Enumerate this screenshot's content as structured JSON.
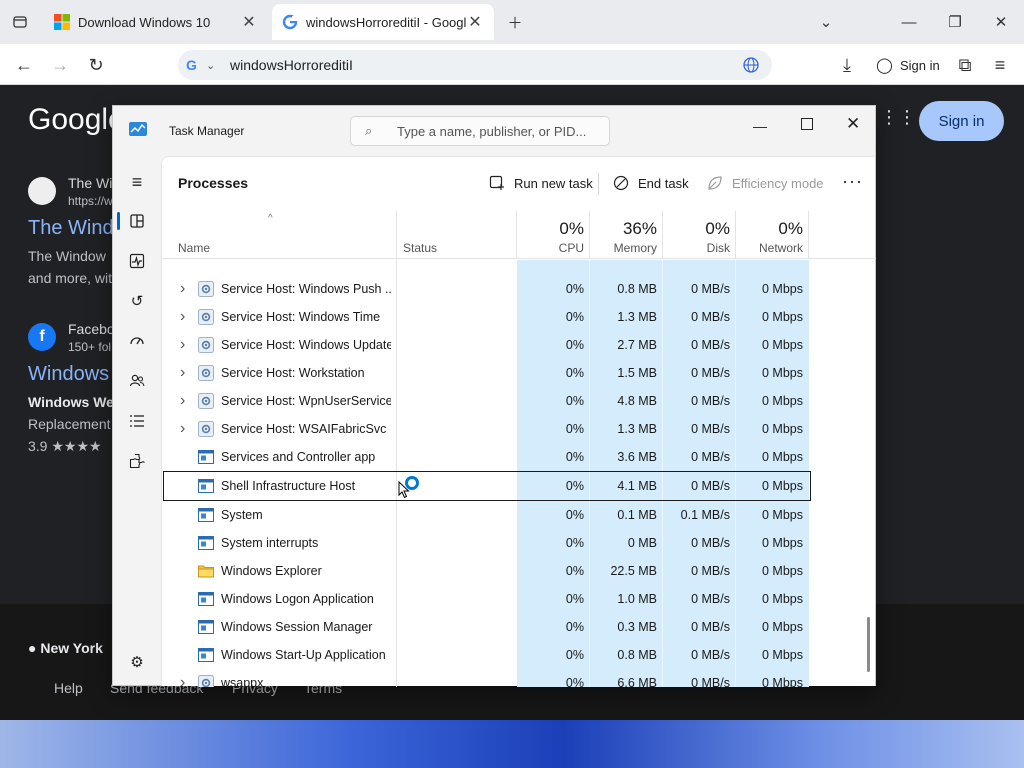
{
  "browser": {
    "tabs": [
      {
        "title": "Download Windows 10",
        "active": false
      },
      {
        "title": "windowsHorroreditiI - Google Se",
        "active": true
      }
    ],
    "address": "windowsHorroreditiI",
    "sign_in": "Sign in"
  },
  "google_page": {
    "logo": "Google",
    "sign_in": "Sign in",
    "result1_site": "The Wi",
    "result1_url": "https://w",
    "result1_title": "The Wind",
    "result1_snip1": "The Window",
    "result1_snip2": "and more, wit",
    "result2_site": "Facebo",
    "result2_sub": "150+ fol",
    "result2_title": "Windows",
    "result2_snip1": "Windows We",
    "result2_snip2": "Replacement",
    "result2_rating": "3.9 ★★★★",
    "footer_location": "New York",
    "footer_links": [
      "Help",
      "Send feedback",
      "Privacy",
      "Terms"
    ]
  },
  "task_manager": {
    "title": "Task Manager",
    "search_placeholder": "Type a name, publisher, or PID...",
    "section": "Processes",
    "run_new_task": "Run new task",
    "end_task": "End task",
    "efficiency_mode": "Efficiency mode",
    "columns": {
      "name": "Name",
      "status": "Status",
      "cpu_pct": "0%",
      "cpu": "CPU",
      "memory_pct": "36%",
      "memory": "Memory",
      "disk_pct": "0%",
      "disk": "Disk",
      "network_pct": "0%",
      "network": "Network"
    },
    "rows": [
      {
        "name": "Service Host: Windows Push ...",
        "expand": true,
        "icon": "gear",
        "cpu": "0%",
        "memory": "0.8 MB",
        "disk": "0 MB/s",
        "network": "0 Mbps"
      },
      {
        "name": "Service Host: Windows Time",
        "expand": true,
        "icon": "gear",
        "cpu": "0%",
        "memory": "1.3 MB",
        "disk": "0 MB/s",
        "network": "0 Mbps"
      },
      {
        "name": "Service Host: Windows Update",
        "expand": true,
        "icon": "gear",
        "cpu": "0%",
        "memory": "2.7 MB",
        "disk": "0 MB/s",
        "network": "0 Mbps"
      },
      {
        "name": "Service Host: Workstation",
        "expand": true,
        "icon": "gear",
        "cpu": "0%",
        "memory": "1.5 MB",
        "disk": "0 MB/s",
        "network": "0 Mbps"
      },
      {
        "name": "Service Host: WpnUserService...",
        "expand": true,
        "icon": "gear",
        "cpu": "0%",
        "memory": "4.8 MB",
        "disk": "0 MB/s",
        "network": "0 Mbps"
      },
      {
        "name": "Service Host: WSAIFabricSvc",
        "expand": true,
        "icon": "gear",
        "cpu": "0%",
        "memory": "1.3 MB",
        "disk": "0 MB/s",
        "network": "0 Mbps"
      },
      {
        "name": "Services and Controller app",
        "expand": false,
        "icon": "app",
        "cpu": "0%",
        "memory": "3.6 MB",
        "disk": "0 MB/s",
        "network": "0 Mbps"
      },
      {
        "name": "Shell Infrastructure Host",
        "expand": false,
        "icon": "app",
        "cpu": "0%",
        "memory": "4.1 MB",
        "disk": "0 MB/s",
        "network": "0 Mbps",
        "selected": true
      },
      {
        "name": "System",
        "expand": false,
        "icon": "app",
        "cpu": "0%",
        "memory": "0.1 MB",
        "disk": "0.1 MB/s",
        "network": "0 Mbps"
      },
      {
        "name": "System interrupts",
        "expand": false,
        "icon": "app",
        "cpu": "0%",
        "memory": "0 MB",
        "disk": "0 MB/s",
        "network": "0 Mbps"
      },
      {
        "name": "Windows Explorer",
        "expand": false,
        "icon": "folder",
        "cpu": "0%",
        "memory": "22.5 MB",
        "disk": "0 MB/s",
        "network": "0 Mbps"
      },
      {
        "name": "Windows Logon Application",
        "expand": false,
        "icon": "app",
        "cpu": "0%",
        "memory": "1.0 MB",
        "disk": "0 MB/s",
        "network": "0 Mbps"
      },
      {
        "name": "Windows Session Manager",
        "expand": false,
        "icon": "app",
        "cpu": "0%",
        "memory": "0.3 MB",
        "disk": "0 MB/s",
        "network": "0 Mbps"
      },
      {
        "name": "Windows Start-Up Application",
        "expand": false,
        "icon": "app",
        "cpu": "0%",
        "memory": "0.8 MB",
        "disk": "0 MB/s",
        "network": "0 Mbps"
      },
      {
        "name": "wsappx",
        "expand": true,
        "icon": "gear",
        "cpu": "0%",
        "memory": "6.6 MB",
        "disk": "0 MB/s",
        "network": "0 Mbps"
      }
    ]
  },
  "colors": {
    "heat": "#d4ecfc",
    "accent": "#0067c0",
    "google_signin": "#a8c7fa"
  }
}
